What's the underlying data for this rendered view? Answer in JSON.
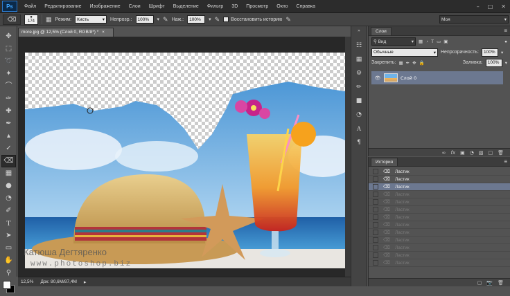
{
  "app": {
    "logo": "Ps"
  },
  "menu": [
    "Файл",
    "Редактирование",
    "Изображение",
    "Слои",
    "Шрифт",
    "Выделение",
    "Фильтр",
    "3D",
    "Просмотр",
    "Окно",
    "Справка"
  ],
  "options": {
    "brush_size": "174",
    "mode_label": "Режим:",
    "mode_value": "Кисть",
    "opacity_label": "Непрозр.:",
    "opacity_value": "100%",
    "flow_label": "Наж.:",
    "flow_value": "100%",
    "restore_history_label": "Восстановить историю",
    "workspace_value": "Моя"
  },
  "document": {
    "tab_title": "more.jpg @ 12,5% (Слой 0, RGB/8*) *"
  },
  "status": {
    "zoom": "12,5%",
    "doc_info": "Док: 80,6M/87,4M"
  },
  "layers": {
    "tab": "Слои",
    "filter_kind": "Вид",
    "blend_mode": "Обычные",
    "opacity_label": "Непрозрачность:",
    "opacity_value": "100%",
    "lock_label": "Закрепить:",
    "fill_label": "Заливка:",
    "fill_value": "100%",
    "layer_name": "Слой 0"
  },
  "history": {
    "tab": "История",
    "items": [
      "Ластик",
      "Ластик",
      "Ластик",
      "Ластик",
      "Ластик",
      "Ластик",
      "Ластик",
      "Ластик",
      "Ластик",
      "Ластик",
      "Ластик",
      "Ластик",
      "Ластик"
    ],
    "active_index": 2
  },
  "watermark": {
    "line1": "Катюша Дегтяренко",
    "line2": "www.photoshop.biz"
  },
  "colors": {
    "accent_selection": "#6c7890",
    "panel_bg": "#535353",
    "dark_bg": "#282828"
  }
}
